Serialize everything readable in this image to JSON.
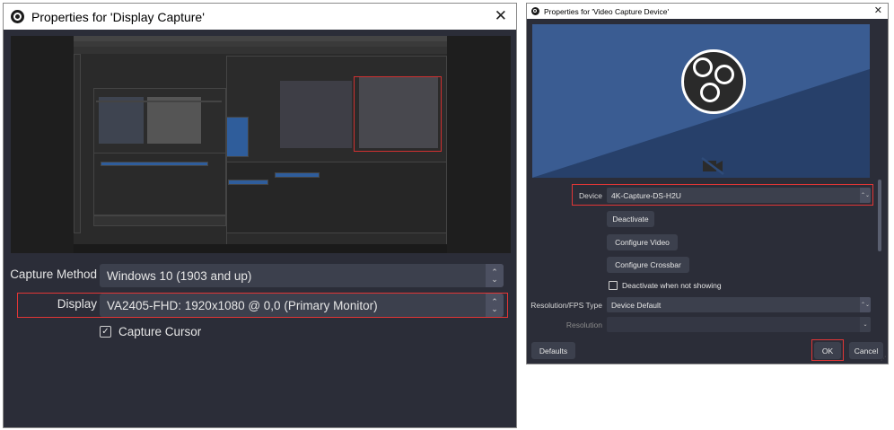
{
  "left_dialog": {
    "title": "Properties for 'Display Capture'",
    "close_glyph": "✕",
    "capture_method": {
      "label": "Capture Method",
      "value": "Windows 10 (1903 and up)"
    },
    "display": {
      "label": "Display",
      "value": "VA2405-FHD: 1920x1080 @ 0,0 (Primary Monitor)"
    },
    "capture_cursor": {
      "label": "Capture Cursor",
      "checked": true,
      "check_glyph": "✓"
    },
    "spin_glyphs": {
      "up": "⌃",
      "down": "⌄"
    }
  },
  "right_dialog": {
    "title": "Properties for 'Video Capture Device'",
    "close_glyph": "✕",
    "device": {
      "label": "Device",
      "value": "4K-Capture-DS-H2U"
    },
    "buttons": {
      "deactivate": "Deactivate",
      "configure_video": "Configure Video",
      "configure_crossbar": "Configure Crossbar",
      "defaults": "Defaults",
      "ok": "OK",
      "cancel": "Cancel"
    },
    "deactivate_when_not_showing": {
      "label": "Deactivate when not showing",
      "checked": false
    },
    "resolution_fps_type": {
      "label": "Resolution/FPS Type",
      "value": "Device Default"
    },
    "resolution": {
      "label": "Resolution",
      "value": ""
    },
    "spin_glyph": "⌃⌄",
    "dropdown_glyph": "⌄",
    "no_camera_icon": "camera-off-icon"
  },
  "colors": {
    "dialog_bg": "#2b2d38",
    "field_bg": "#3c404d",
    "highlight_red": "#e23636",
    "preview_blue": "#2e4b79"
  }
}
